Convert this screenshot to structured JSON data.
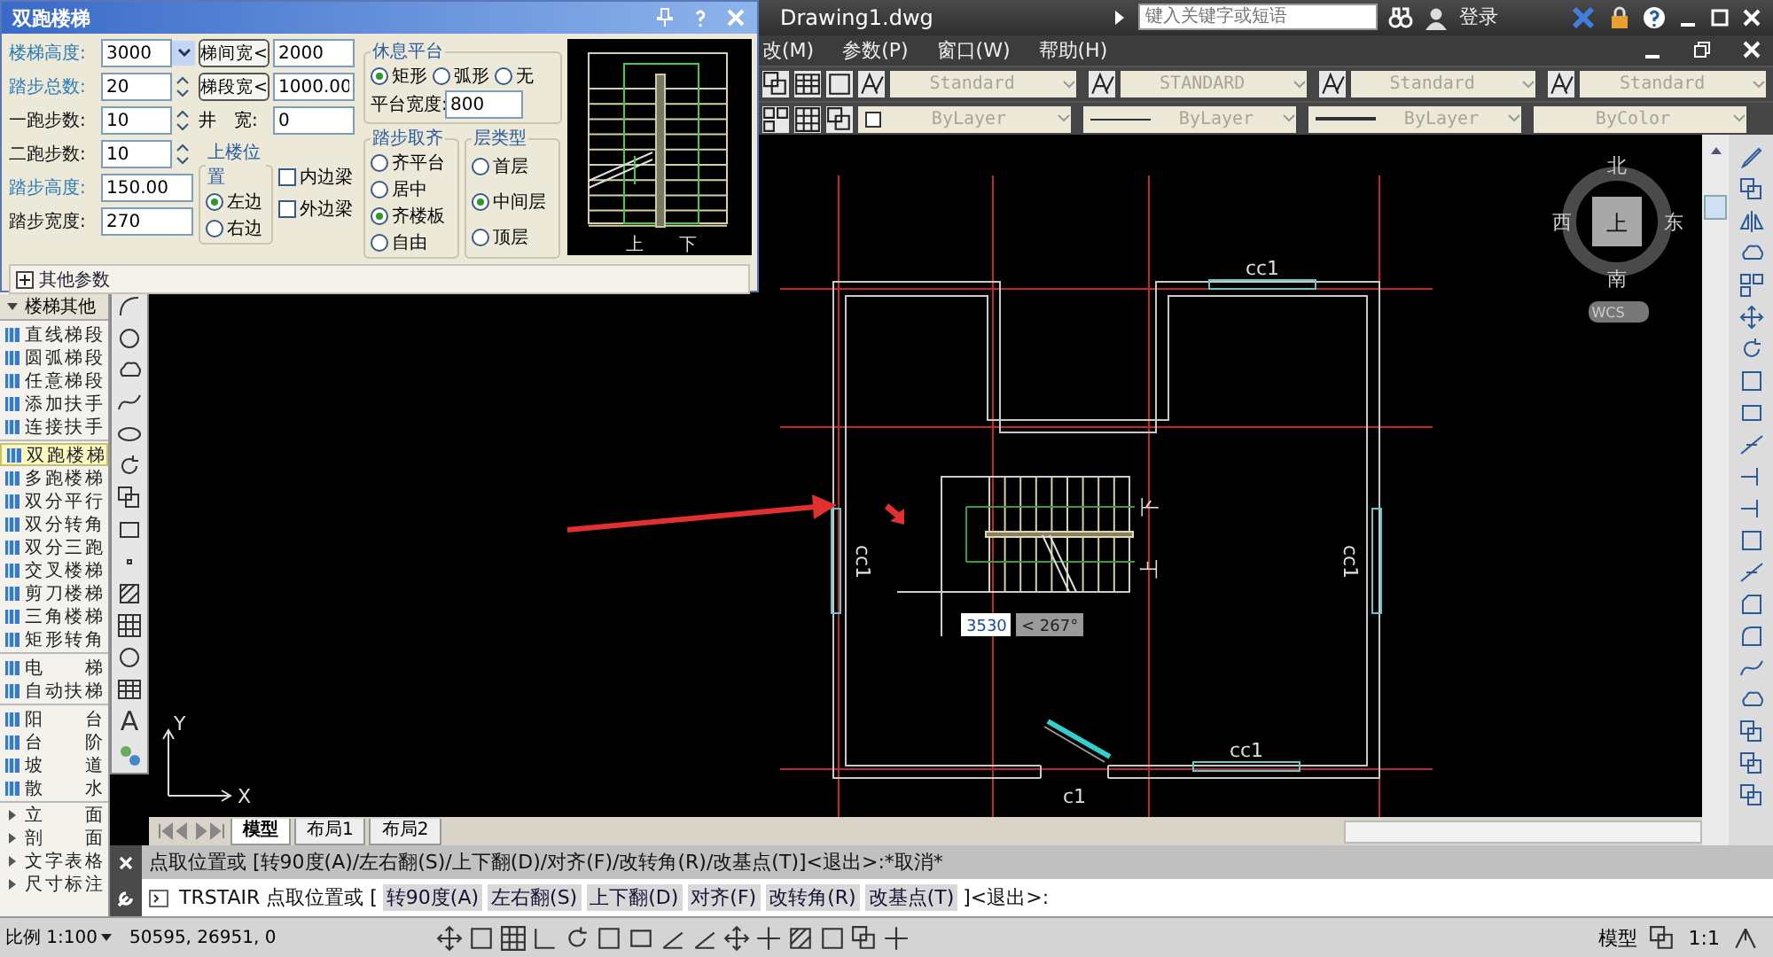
{
  "app": {
    "file_title": "Drawing1.dwg",
    "search_placeholder": "键入关键字或短语",
    "login": "登录"
  },
  "menus": [
    {
      "label": "改(M)"
    },
    {
      "label": "参数(P)"
    },
    {
      "label": "窗口(W)"
    },
    {
      "label": "帮助(H)"
    }
  ],
  "style_toolbar": [
    {
      "value": "Standard"
    },
    {
      "value": "STANDARD"
    },
    {
      "value": "Standard"
    },
    {
      "value": "Standard"
    }
  ],
  "property_toolbar": [
    {
      "value": "ByLayer",
      "kind": "color"
    },
    {
      "value": "ByLayer",
      "kind": "linetype"
    },
    {
      "value": "ByLayer",
      "kind": "lineweight"
    },
    {
      "value": "ByColor",
      "kind": "plot"
    }
  ],
  "dialog": {
    "title": "双跑楼梯",
    "fields": [
      {
        "label": "楼梯高度:",
        "value": "3000",
        "kind": "combo",
        "accent": true
      },
      {
        "label": "踏步总数:",
        "value": "20",
        "kind": "spin",
        "accent": true
      },
      {
        "label": "一跑步数:",
        "value": "10",
        "kind": "spin",
        "accent": false
      },
      {
        "label": "二跑步数:",
        "value": "10",
        "kind": "spin",
        "accent": false
      },
      {
        "label": "踏步高度:",
        "value": "150.00",
        "kind": "text",
        "accent": true
      },
      {
        "label": "踏步宽度:",
        "value": "270",
        "kind": "text",
        "accent": false
      }
    ],
    "widths": [
      {
        "kind": "button",
        "label": "梯间宽<",
        "value": "2000"
      },
      {
        "kind": "button",
        "label": "梯段宽<",
        "value": "1000.00"
      },
      {
        "kind": "label",
        "label": "井　宽:",
        "value": "0"
      }
    ],
    "up_side": {
      "title": "上楼位置",
      "options": [
        {
          "label": "左边",
          "selected": true
        },
        {
          "label": "右边",
          "selected": false
        }
      ]
    },
    "beams": [
      {
        "label": "内边梁",
        "checked": false
      },
      {
        "label": "外边梁",
        "checked": false
      }
    ],
    "landing": {
      "title": "休息平台",
      "options": [
        {
          "label": "矩形",
          "selected": true
        },
        {
          "label": "弧形",
          "selected": false
        },
        {
          "label": "无",
          "selected": false
        }
      ],
      "width_label": "平台宽度:",
      "width_value": "800"
    },
    "step_align": {
      "title": "踏步取齐",
      "options": [
        {
          "label": "齐平台",
          "selected": false
        },
        {
          "label": "居中",
          "selected": false
        },
        {
          "label": "齐楼板",
          "selected": true
        },
        {
          "label": "自由",
          "selected": false
        }
      ]
    },
    "floor_type": {
      "title": "层类型",
      "options": [
        {
          "label": "首层",
          "selected": false
        },
        {
          "label": "中间层",
          "selected": true
        },
        {
          "label": "顶层",
          "selected": false
        }
      ]
    },
    "preview_labels": [
      "上",
      "下"
    ],
    "more": "其他参数"
  },
  "palette": {
    "title": "楼梯其他",
    "groups": [
      {
        "items": [
          {
            "label": "直线梯段",
            "selected": false
          },
          {
            "label": "圆弧梯段",
            "selected": false
          },
          {
            "label": "任意梯段",
            "selected": false
          },
          {
            "label": "添加扶手",
            "selected": false
          },
          {
            "label": "连接扶手",
            "selected": false
          }
        ]
      },
      {
        "items": [
          {
            "label": "双跑楼梯",
            "selected": true
          },
          {
            "label": "多跑楼梯",
            "selected": false
          },
          {
            "label": "双分平行",
            "selected": false
          },
          {
            "label": "双分转角",
            "selected": false
          },
          {
            "label": "双分三跑",
            "selected": false
          },
          {
            "label": "交叉楼梯",
            "selected": false
          },
          {
            "label": "剪刀楼梯",
            "selected": false
          },
          {
            "label": "三角楼梯",
            "selected": false
          },
          {
            "label": "矩形转角",
            "selected": false
          }
        ]
      },
      {
        "items": [
          {
            "label": "电 梯",
            "selected": false
          },
          {
            "label": "自动扶梯",
            "selected": false
          }
        ]
      },
      {
        "items": [
          {
            "label": "阳 台",
            "selected": false
          },
          {
            "label": "台 阶",
            "selected": false
          },
          {
            "label": "坡 道",
            "selected": false
          },
          {
            "label": "散 水",
            "selected": false
          }
        ]
      }
    ],
    "collapsed": [
      {
        "label": "立 面"
      },
      {
        "label": "剖 面"
      },
      {
        "label": "文字表格"
      },
      {
        "label": "尺寸标注"
      }
    ]
  },
  "draw_toolbar": {
    "text_tool": "A"
  },
  "canvas": {
    "window_labels": [
      "cc1",
      "cc1",
      "cc1",
      "cc1"
    ],
    "door_label": "c1",
    "stair_labels": [
      "下",
      "上"
    ],
    "dynamic_input": {
      "value": "3530",
      "angle": "< 267°"
    },
    "compass": {
      "north": "北",
      "east": "东",
      "south": "南",
      "west": "西",
      "view": "上",
      "ucs": "WCS"
    },
    "axes": {
      "x": "X",
      "y": "Y"
    }
  },
  "layout_tabs": [
    {
      "label": "模型",
      "selected": true
    },
    {
      "label": "布局1",
      "selected": false
    },
    {
      "label": "布局2",
      "selected": false
    }
  ],
  "command": {
    "history": "点取位置或 [转90度(A)/左右翻(S)/上下翻(D)/对齐(F)/改转角(R)/改基点(T)]<退出>:*取消*",
    "prompt": "TRSTAIR 点取位置或 [",
    "options": [
      "转90度(A)",
      "左右翻(S)",
      "上下翻(D)",
      "对齐(F)",
      "改转角(R)",
      "改基点(T)"
    ],
    "suffix": "]<退出>:"
  },
  "status_bar": {
    "scale": "比例 1:100",
    "coords": "50595, 26951, 0",
    "space": "模型",
    "annotation_scale": "1:1"
  }
}
